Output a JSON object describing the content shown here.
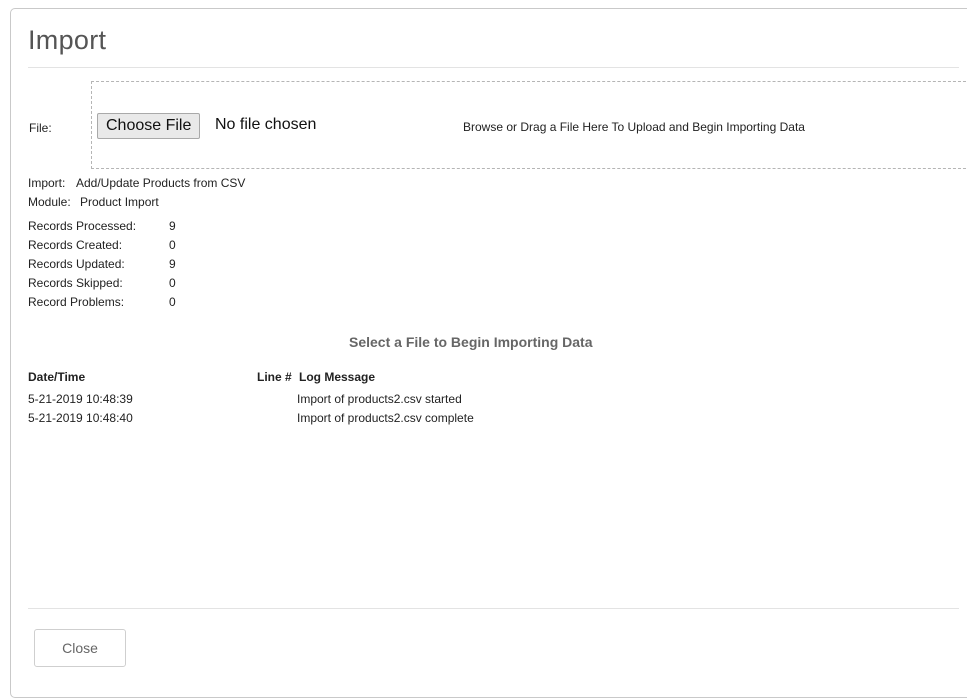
{
  "dialog": {
    "title": "Import",
    "close_label": "Close"
  },
  "upload": {
    "file_label": "File:",
    "choose_button": "Choose File",
    "status": "No file chosen",
    "hint": "Browse or Drag a File Here To Upload and Begin Importing Data"
  },
  "details": {
    "import_label": "Import:",
    "import_value": "Add/Update Products from CSV",
    "module_label": "Module:",
    "module_value": "Product Import"
  },
  "stats": [
    {
      "label": "Records Processed:",
      "value": "9"
    },
    {
      "label": "Records Created:",
      "value": "0"
    },
    {
      "label": "Records Updated:",
      "value": "9"
    },
    {
      "label": "Records Skipped:",
      "value": "0"
    },
    {
      "label": "Record Problems:",
      "value": "0"
    }
  ],
  "status_message": "Select a File to Begin Importing Data",
  "log": {
    "headers": {
      "datetime": "Date/Time",
      "line": "Line #",
      "message": "Log Message"
    },
    "rows": [
      {
        "datetime": "5-21-2019 10:48:39",
        "line": "",
        "message": "Import of products2.csv started"
      },
      {
        "datetime": "5-21-2019 10:48:40",
        "line": "",
        "message": "Import of products2.csv complete"
      }
    ]
  }
}
